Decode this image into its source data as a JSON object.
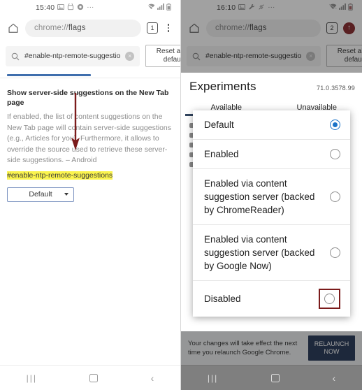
{
  "left": {
    "status": {
      "time": "15:40",
      "icons": [
        "image-icon",
        "capture-icon",
        "chrome-icon",
        "more-icon"
      ],
      "signal": [
        "wifi-icon",
        "cellular-icon",
        "battery-icon"
      ]
    },
    "omnibox": {
      "home": "home-icon",
      "url_prefix": "chrome://",
      "url_suffix": "flags",
      "url_full": "chrome://flags",
      "tab_count": "1",
      "menu": "kebab-menu-icon"
    },
    "search": {
      "query": "#enable-ntp-remote-suggestio",
      "clear": "×",
      "magnifier": "search-icon"
    },
    "reset_button": "Reset all to default",
    "flag": {
      "title": "Show server-side suggestions on the New Tab page",
      "description": "If enabled, the list of content suggestions on the New Tab page will contain server-side suggestions (e.g., Articles for you). Furthermore, it allows to override the source used to retrieve these server-side suggestions. – Android",
      "id": "#enable-ntp-remote-suggestions",
      "select_value": "Default"
    },
    "nav": {
      "recent": "|||",
      "home": "home-square-icon",
      "back": "‹"
    }
  },
  "right": {
    "status": {
      "time": "16:10",
      "icons": [
        "image-icon",
        "tool-icon",
        "link-icon",
        "more-icon"
      ],
      "signal": [
        "wifi-icon",
        "cellular-icon",
        "battery-icon"
      ]
    },
    "omnibox": {
      "home": "home-icon",
      "url_full": "chrome://flags",
      "url_prefix": "chrome://",
      "url_suffix": "flags",
      "tab_count": "2",
      "update_badge": "↑"
    },
    "search": {
      "query": "#enable-ntp-remote-suggestio",
      "clear": "×",
      "magnifier": "search-icon"
    },
    "reset_button": "Reset all to default",
    "experiments": {
      "heading": "Experiments",
      "version": "71.0.3578.99"
    },
    "tabs": [
      {
        "label": "Available",
        "active": true
      },
      {
        "label": "Unavailable",
        "active": false
      }
    ],
    "dialog": {
      "options": [
        {
          "label": "Default",
          "selected": true,
          "highlighted": false
        },
        {
          "label": "Enabled",
          "selected": false,
          "highlighted": false
        },
        {
          "label": "Enabled via content suggestion server (backed by ChromeReader)",
          "selected": false,
          "highlighted": false
        },
        {
          "label": "Enabled via content suggestion server (backed by Google Now)",
          "selected": false,
          "highlighted": false
        },
        {
          "label": "Disabled",
          "selected": false,
          "highlighted": true
        }
      ]
    },
    "relaunch": {
      "message": "Your changes will take effect the next time you relaunch Google Chrome.",
      "button": "RELAUNCH NOW"
    },
    "nav": {
      "recent": "|||",
      "home": "home-square-icon",
      "back": "‹"
    }
  },
  "colors": {
    "accent_blue": "#3f6ead",
    "radio_blue": "#1a73c8",
    "annotation_red": "#7b1b1b",
    "highlight_yellow": "#fbf44e",
    "relaunch_navy": "#26406e",
    "update_red": "#b3282d"
  }
}
